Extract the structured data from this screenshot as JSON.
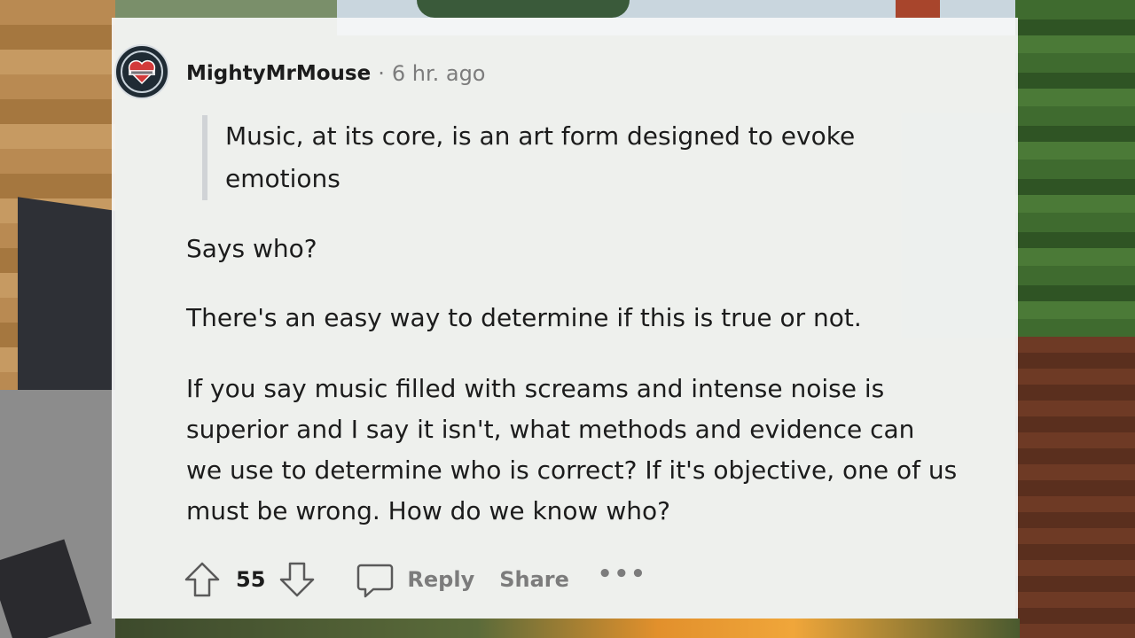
{
  "comment": {
    "username": "MightyMrMouse",
    "separator": "·",
    "timestamp": "6 hr. ago",
    "quote": "Music, at its core, is an art form designed to evoke emotions",
    "paragraphs": [
      "Says who?",
      "There's an easy way to determine if this is true or not.",
      "If you say music filled with screams and intense noise is superior and I say it isn't, what methods and evidence can we use to determine who is correct? If it's objective, one of us must be wrong. How do we know who?"
    ],
    "actions": {
      "upvote_icon": "arrow-up-icon",
      "vote_count": "55",
      "downvote_icon": "arrow-down-icon",
      "reply_icon": "speech-bubble-icon",
      "reply_label": "Reply",
      "share_label": "Share",
      "more_label": "•••"
    }
  },
  "colors": {
    "card_bg": "#f6f7f8",
    "text": "#1c1c1c",
    "muted": "#7c7c7c",
    "quote_bar": "#d0d3d6",
    "avatar_bg": "#1f2b34",
    "avatar_heart": "#d23a3a"
  }
}
